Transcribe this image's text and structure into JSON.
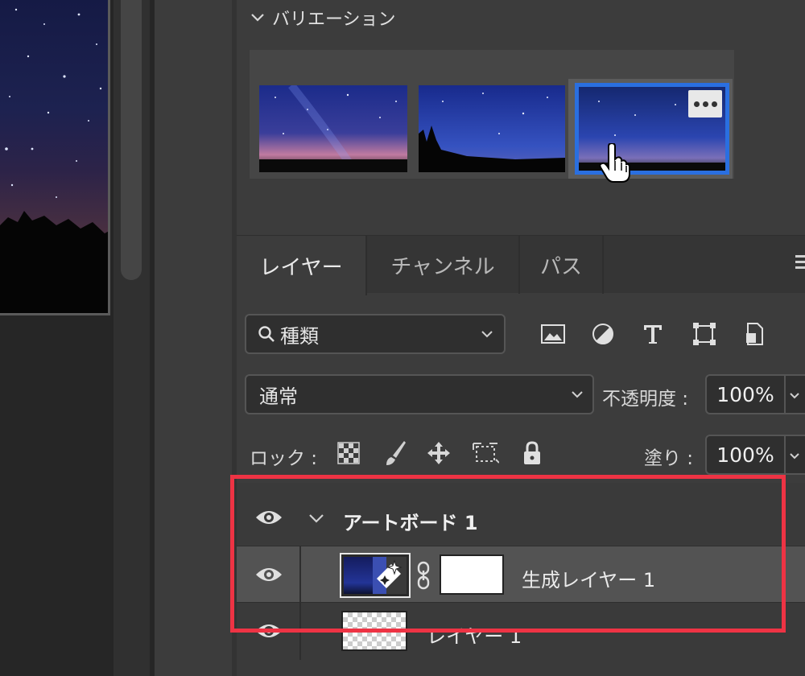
{
  "variations": {
    "title": "バリエーション",
    "thumbnails": [
      {
        "name": "milky-way-horizon",
        "selected": false
      },
      {
        "name": "tree-silhouette-sky",
        "selected": false
      },
      {
        "name": "blue-night-sky",
        "selected": true
      }
    ]
  },
  "tabs": [
    {
      "label": "レイヤー",
      "active": true
    },
    {
      "label": "チャンネル",
      "active": false
    },
    {
      "label": "パス",
      "active": false
    }
  ],
  "filter": {
    "label": "種類"
  },
  "blend": {
    "mode": "通常",
    "opacity_label": "不透明度 :",
    "opacity_value": "100%"
  },
  "lock": {
    "label": "ロック :",
    "fill_label": "塗り :",
    "fill_value": "100%"
  },
  "layers": [
    {
      "name": "アートボード 1",
      "type": "artboard",
      "visible": true,
      "expanded": true
    },
    {
      "name": "生成レイヤー 1",
      "type": "generative",
      "visible": true,
      "selected": true
    },
    {
      "name": "レイヤー 1",
      "type": "pixel",
      "visible": true
    }
  ],
  "colors": {
    "highlight": "#ee3344",
    "selection": "#2a6fe0"
  }
}
